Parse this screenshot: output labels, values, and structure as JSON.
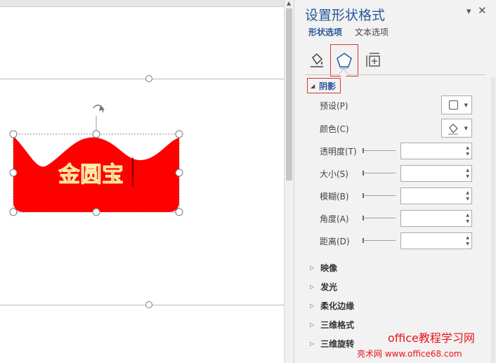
{
  "pane": {
    "title": "设置形状格式",
    "tabs": {
      "shape_options": "形状选项",
      "text_options": "文本选项"
    },
    "icon_tabs": [
      "fill-line-icon",
      "effects-icon",
      "size-properties-icon"
    ],
    "sections": {
      "shadow": {
        "label": "阴影",
        "expanded": true,
        "preset_label": "预设(P)",
        "color_label": "颜色(C)",
        "properties": [
          {
            "label": "透明度(T)",
            "value": ""
          },
          {
            "label": "大小(S)",
            "value": ""
          },
          {
            "label": "模糊(B)",
            "value": ""
          },
          {
            "label": "角度(A)",
            "value": ""
          },
          {
            "label": "距离(D)",
            "value": ""
          }
        ]
      },
      "collapsed": [
        "映像",
        "发光",
        "柔化边缘",
        "三维格式",
        "三维旋转"
      ]
    }
  },
  "shape": {
    "text": "金圆宝",
    "fill_color": "#ff0000",
    "text_color": "#e8b04a"
  },
  "colors": {
    "accent": "#2b579a",
    "highlight_border": "#d6363a"
  },
  "watermark": {
    "line1": "office教程学习网",
    "line2": "亮术网 www.office68.com"
  }
}
